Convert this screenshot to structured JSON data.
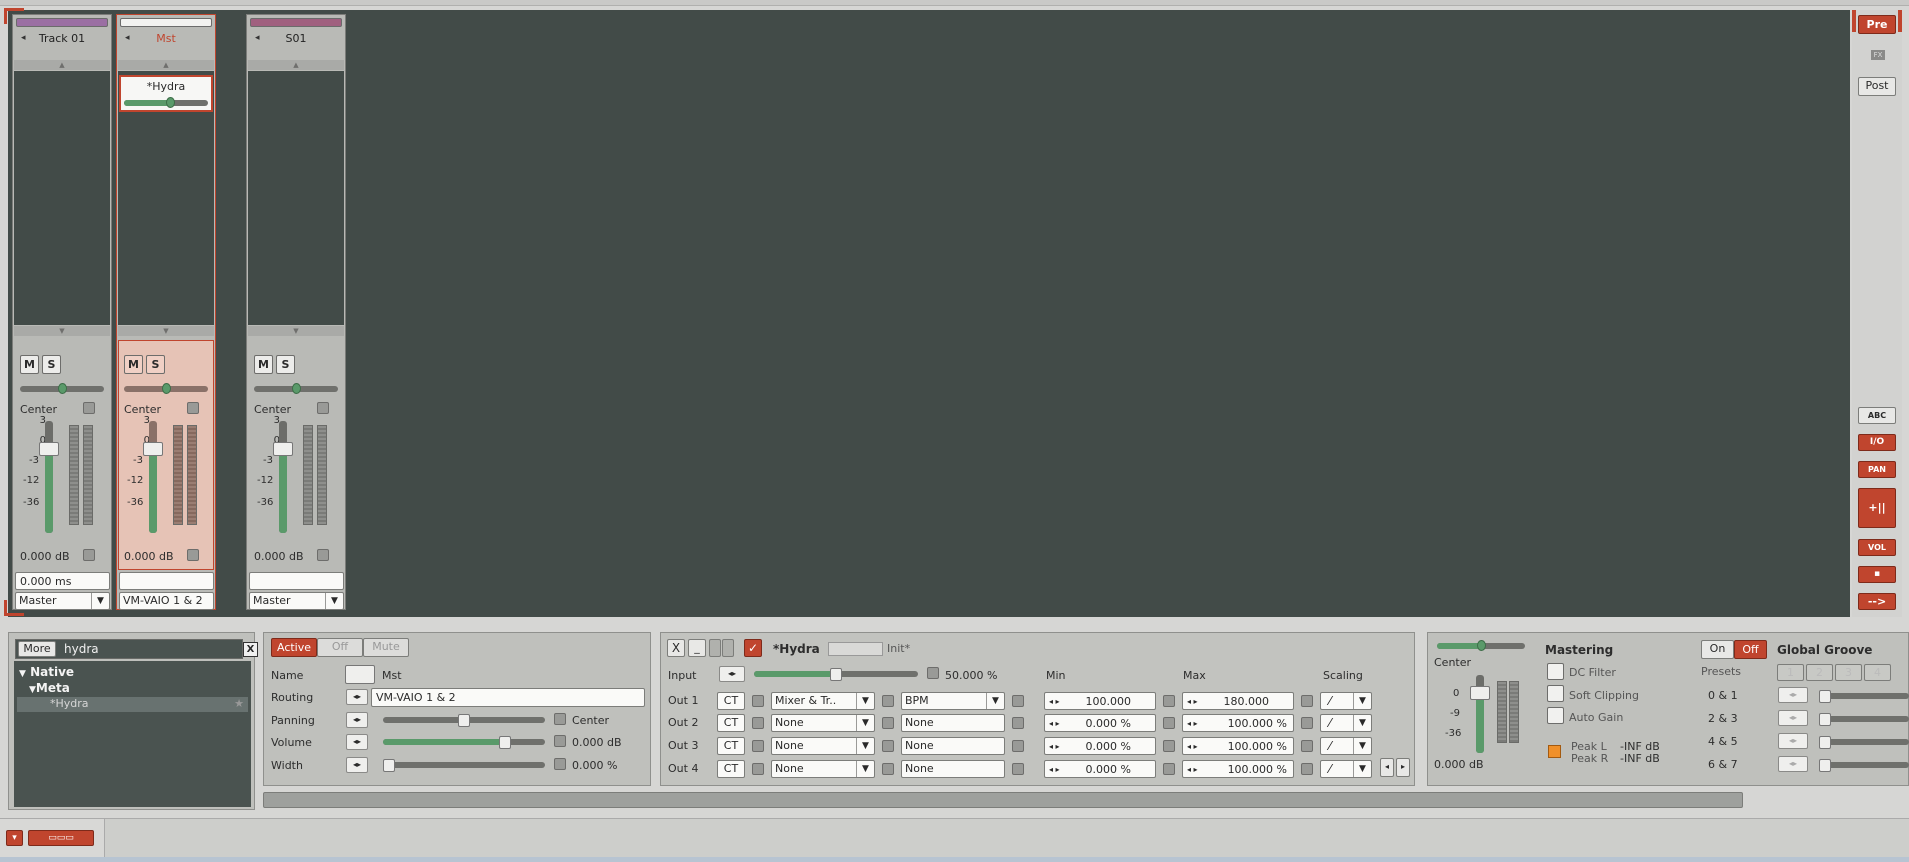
{
  "tracks": [
    {
      "name": "Track 01",
      "color": "#9b6fa3",
      "pan_label": "Center",
      "volume_db": "0.000 dB",
      "delay": "0.000 ms",
      "output": "Master",
      "scale": [
        "3",
        "0",
        "-3",
        "-12",
        "-36"
      ]
    },
    {
      "name": "Mst",
      "color": "#f2f2f0",
      "pan_label": "Center",
      "volume_db": "0.000 dB",
      "delay": "",
      "output": "VM-VAIO 1 & 2",
      "device": "*Hydra",
      "scale": [
        "3",
        "0",
        "-3",
        "-12",
        "-36"
      ]
    },
    {
      "name": "S01",
      "color": "#a0607f",
      "pan_label": "Center",
      "volume_db": "0.000 dB",
      "delay": "",
      "output": "Master",
      "scale": [
        "3",
        "0",
        "-3",
        "-12",
        "-36"
      ]
    }
  ],
  "strip_buttons": {
    "mute": "M",
    "solo": "S"
  },
  "right_bar": {
    "pre": "Pre",
    "fx": "FX",
    "post": "Post",
    "icons": [
      "ABC",
      "I/O",
      "PAN",
      "+||",
      "VOL",
      "",
      "-->"
    ]
  },
  "browser": {
    "more": "More",
    "search": "hydra",
    "tree": [
      "Native",
      "Meta",
      "*Hydra"
    ],
    "clear": "X"
  },
  "track_props": {
    "state_buttons": [
      "Active",
      "Off",
      "Mute"
    ],
    "labels": [
      "Name",
      "Routing",
      "Panning",
      "Volume",
      "Width"
    ],
    "name": "Mst",
    "routing": "VM-VAIO 1 & 2",
    "panning": "Center",
    "volume": "0.000 dB",
    "width": "0.000 %",
    "panning_level": 0.5,
    "volume_level": 0.75,
    "width_level": 0.0
  },
  "hydra": {
    "title": "*Hydra",
    "preset": "Init*",
    "input_label": "Input",
    "input_value": "50.000 %",
    "input_level": 0.5,
    "headers": {
      "min": "Min",
      "max": "Max",
      "scaling": "Scaling"
    },
    "outs": [
      {
        "label": "Out 1",
        "ct": "CT",
        "target": "Mixer & Tr..",
        "param": "BPM",
        "min": "100.000",
        "max": "180.000"
      },
      {
        "label": "Out 2",
        "ct": "CT",
        "target": "None",
        "param": "None",
        "min": "0.000 %",
        "max": "100.000 %"
      },
      {
        "label": "Out 3",
        "ct": "CT",
        "target": "None",
        "param": "None",
        "min": "0.000 %",
        "max": "100.000 %"
      },
      {
        "label": "Out 4",
        "ct": "CT",
        "target": "None",
        "param": "None",
        "min": "0.000 %",
        "max": "100.000 %"
      }
    ],
    "toolbar": {
      "close": "X",
      "min": "_",
      "check": "✓"
    }
  },
  "master": {
    "pan_label": "Center",
    "volume_db": "0.000 dB",
    "scale": [
      "0",
      "-9",
      "-36"
    ],
    "mastering": "Mastering",
    "dc_filter": "DC Filter",
    "soft_clipping": "Soft Clipping",
    "auto_gain": "Auto Gain",
    "peak_l": "Peak L",
    "peak_r": "Peak R",
    "peak_l_val": "-INF dB",
    "peak_r_val": "-INF dB",
    "on": "On",
    "off": "Off",
    "global_groove": "Global Groove",
    "presets": "Presets",
    "groove_pairs": [
      "0 & 1",
      "2 & 3",
      "4 & 5",
      "6 & 7"
    ],
    "groove_nums": [
      "1",
      "2",
      "3",
      "4"
    ]
  },
  "colors": {
    "accent": "#c0452e",
    "background": "#424b48",
    "fader": "#5a9a6a"
  }
}
